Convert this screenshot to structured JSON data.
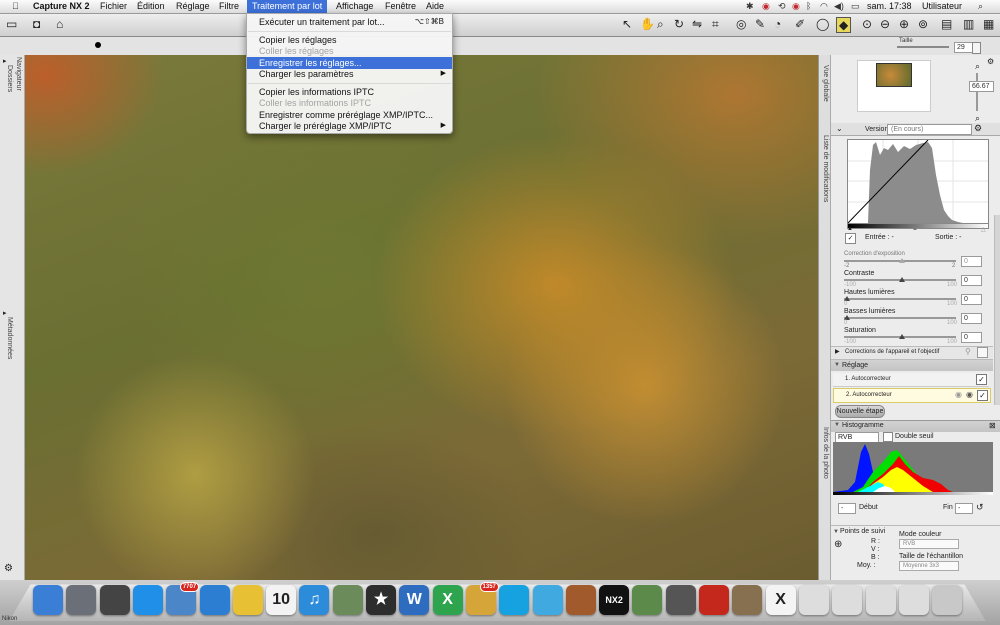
{
  "menubar": {
    "app_name": "Capture NX 2",
    "items": [
      "Fichier",
      "Édition",
      "Réglage",
      "Filtre",
      "Traitement par lot",
      "Affichage",
      "Fenêtre",
      "Aide"
    ],
    "clock": "sam. 17:38",
    "user": "Utilisateur"
  },
  "toolbar": {
    "size_label": "Taille",
    "size_value": "29"
  },
  "menu": {
    "items": [
      {
        "label": "Exécuter un traitement par lot...",
        "shortcut": "⌥⇧⌘B",
        "enabled": true
      },
      {
        "label": "Copier les réglages",
        "enabled": true
      },
      {
        "label": "Coller les réglages",
        "enabled": false
      },
      {
        "label": "Enregistrer les réglages...",
        "enabled": true,
        "highlighted": true
      },
      {
        "label": "Charger les paramètres",
        "submenu": true,
        "enabled": true
      },
      {
        "label": "Copier les informations IPTC",
        "enabled": true
      },
      {
        "label": "Coller les informations IPTC",
        "enabled": false
      },
      {
        "label": "Enregistrer comme préréglage XMP/IPTC...",
        "enabled": true
      },
      {
        "label": "Charger le préréglage XMP/IPTC",
        "submenu": true,
        "enabled": true
      }
    ]
  },
  "left_sidebar": {
    "tabs": [
      "Dossiers",
      "Navigateur",
      "Métadonnées"
    ]
  },
  "right_panel": {
    "side_tabs": [
      "Vue globale",
      "Liste de modifications",
      "Infos de la photo"
    ],
    "zoom_value": "66.67",
    "version_label": "Version",
    "version_value": "(En cours)",
    "input_label": "Entrée : -",
    "output_label": "Sortie : -",
    "sliders": [
      {
        "label": "Correction d'exposition",
        "min": "-2",
        "max": "2",
        "value": "0",
        "enabled": false
      },
      {
        "label": "Contraste",
        "min": "-100",
        "max": "100",
        "value": "0",
        "enabled": true
      },
      {
        "label": "Hautes lumières",
        "min": "0",
        "max": "100",
        "value": "0",
        "enabled": true
      },
      {
        "label": "Basses lumières",
        "min": "0",
        "max": "100",
        "value": "0",
        "enabled": true
      },
      {
        "label": "Saturation",
        "min": "-100",
        "max": "100",
        "value": "0",
        "enabled": true
      }
    ],
    "camera_corrections": "Corrections de l'appareil et l'objectif",
    "adjust_section": "Réglage",
    "steps": [
      "1. Autocorrecteur",
      "2. Autocorrecteur"
    ],
    "new_step_button": "Nouvelle étape",
    "histogram_section": "Histogramme",
    "histogram_channel": "RVB",
    "double_threshold": "Double seuil",
    "start_label": "Début",
    "start_value": "-",
    "end_label": "Fin",
    "end_value": "-",
    "tracking_points": "Points de suivi",
    "r_label": "R :",
    "v_label": "V :",
    "b_label": "B :",
    "avg_label": "Moy. :",
    "color_mode_label": "Mode couleur",
    "color_mode_value": "RVB",
    "sample_size_label": "Taille de l'échantillon",
    "sample_size_value": "Moyenne 3x3"
  },
  "dock": {
    "items": [
      {
        "name": "finder",
        "label": "",
        "color": "#3a7fd5"
      },
      {
        "name": "launchpad",
        "label": "",
        "color": "#6b6f78"
      },
      {
        "name": "mission-control",
        "label": "",
        "color": "#444"
      },
      {
        "name": "app-store",
        "label": "",
        "color": "#1f8fe8"
      },
      {
        "name": "mail-stamp",
        "label": "",
        "color": "#4a86c8",
        "badge": "7707"
      },
      {
        "name": "safari",
        "label": "",
        "color": "#2b7ed1"
      },
      {
        "name": "chrome",
        "label": "",
        "color": "#e8c033"
      },
      {
        "name": "calendar",
        "label": "10",
        "color": "#f3f3f3"
      },
      {
        "name": "itunes",
        "label": "♫",
        "color": "#2c8cd9"
      },
      {
        "name": "iphoto",
        "label": "",
        "color": "#6b8c5a"
      },
      {
        "name": "imovie",
        "label": "★",
        "color": "#2d2d2d"
      },
      {
        "name": "word",
        "label": "W",
        "color": "#2d6cbf"
      },
      {
        "name": "excel",
        "label": "X",
        "color": "#2ea44f"
      },
      {
        "name": "mail",
        "label": "",
        "color": "#d6a53a",
        "badge": "1357"
      },
      {
        "name": "skype",
        "label": "",
        "color": "#16a2e0"
      },
      {
        "name": "messenger",
        "label": "",
        "color": "#3fa9e0"
      },
      {
        "name": "presentation",
        "label": "",
        "color": "#a05a2c"
      },
      {
        "name": "capture-nx2",
        "label": "NX2",
        "color": "#111"
      },
      {
        "name": "preview",
        "label": "",
        "color": "#5c8a4a"
      },
      {
        "name": "image-capture",
        "label": "",
        "color": "#555"
      },
      {
        "name": "acrobat",
        "label": "",
        "color": "#c4281d"
      },
      {
        "name": "gimp",
        "label": "",
        "color": "#867050"
      },
      {
        "name": "x11",
        "label": "X",
        "color": "#f4f4f4"
      },
      {
        "name": "stack-1",
        "label": "",
        "color": "#ddd"
      },
      {
        "name": "stack-2",
        "label": "",
        "color": "#ddd"
      },
      {
        "name": "stack-3",
        "label": "",
        "color": "#ddd"
      },
      {
        "name": "stack-4",
        "label": "",
        "color": "#ddd"
      },
      {
        "name": "trash",
        "label": "",
        "color": "#c8c8c8"
      }
    ]
  },
  "status_bar_left": "Nikon"
}
